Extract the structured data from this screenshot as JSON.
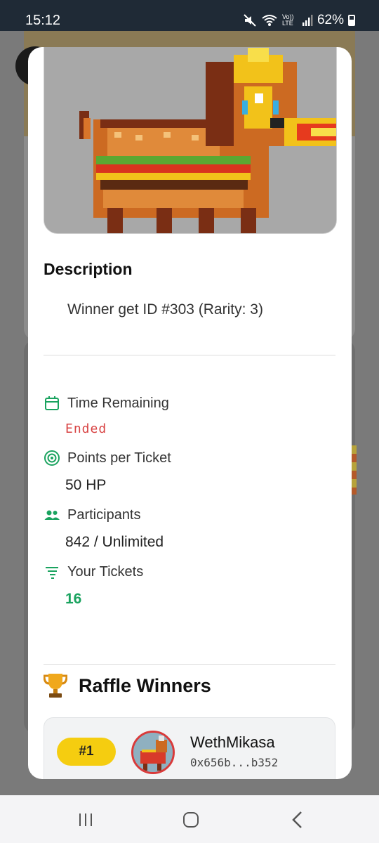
{
  "status_bar": {
    "time": "15:12",
    "battery": "62%",
    "icons": [
      "mute-icon",
      "wifi-icon",
      "volte-icon",
      "signal-icon",
      "battery-icon"
    ],
    "volte_label": "Vo)) LTE"
  },
  "modal": {
    "description_title": "Description",
    "description_text": "Winner get ID #303 (Rarity: 3)",
    "time_remaining": {
      "label": "Time Remaining",
      "value": "Ended",
      "icon": "calendar-icon"
    },
    "points_per_ticket": {
      "label": "Points per Ticket",
      "value": "50 HP",
      "icon": "target-icon"
    },
    "participants": {
      "label": "Participants",
      "value": "842 / Unlimited",
      "icon": "people-icon"
    },
    "your_tickets": {
      "label": "Your Tickets",
      "value": "16",
      "icon": "list-icon"
    },
    "winners_title": "Raffle Winners",
    "winners_icon": "trophy-icon",
    "winners": [
      {
        "rank": "#1",
        "name": "WethMikasa",
        "address": "0x656b...b352"
      }
    ]
  },
  "nav_bar": {
    "items": [
      "recent-apps-icon",
      "home-icon",
      "back-icon"
    ]
  },
  "colors": {
    "accent_green": "#1aa35f",
    "ended_red": "#d84343",
    "rank_yellow": "#f5cd10"
  }
}
